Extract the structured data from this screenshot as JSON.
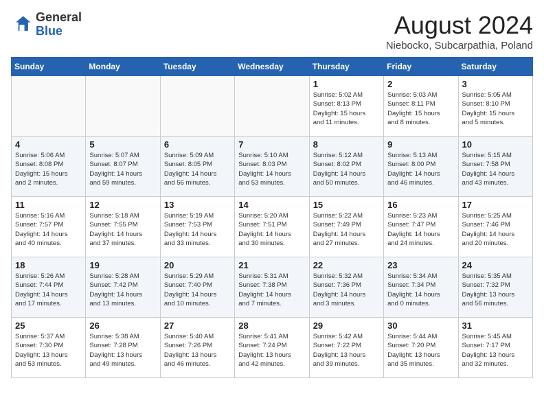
{
  "header": {
    "logo_general": "General",
    "logo_blue": "Blue",
    "month_year": "August 2024",
    "location": "Niebocko, Subcarpathia, Poland"
  },
  "days_of_week": [
    "Sunday",
    "Monday",
    "Tuesday",
    "Wednesday",
    "Thursday",
    "Friday",
    "Saturday"
  ],
  "weeks": [
    [
      {
        "day": "",
        "info": ""
      },
      {
        "day": "",
        "info": ""
      },
      {
        "day": "",
        "info": ""
      },
      {
        "day": "",
        "info": ""
      },
      {
        "day": "1",
        "info": "Sunrise: 5:02 AM\nSunset: 8:13 PM\nDaylight: 15 hours\nand 11 minutes."
      },
      {
        "day": "2",
        "info": "Sunrise: 5:03 AM\nSunset: 8:11 PM\nDaylight: 15 hours\nand 8 minutes."
      },
      {
        "day": "3",
        "info": "Sunrise: 5:05 AM\nSunset: 8:10 PM\nDaylight: 15 hours\nand 5 minutes."
      }
    ],
    [
      {
        "day": "4",
        "info": "Sunrise: 5:06 AM\nSunset: 8:08 PM\nDaylight: 15 hours\nand 2 minutes."
      },
      {
        "day": "5",
        "info": "Sunrise: 5:07 AM\nSunset: 8:07 PM\nDaylight: 14 hours\nand 59 minutes."
      },
      {
        "day": "6",
        "info": "Sunrise: 5:09 AM\nSunset: 8:05 PM\nDaylight: 14 hours\nand 56 minutes."
      },
      {
        "day": "7",
        "info": "Sunrise: 5:10 AM\nSunset: 8:03 PM\nDaylight: 14 hours\nand 53 minutes."
      },
      {
        "day": "8",
        "info": "Sunrise: 5:12 AM\nSunset: 8:02 PM\nDaylight: 14 hours\nand 50 minutes."
      },
      {
        "day": "9",
        "info": "Sunrise: 5:13 AM\nSunset: 8:00 PM\nDaylight: 14 hours\nand 46 minutes."
      },
      {
        "day": "10",
        "info": "Sunrise: 5:15 AM\nSunset: 7:58 PM\nDaylight: 14 hours\nand 43 minutes."
      }
    ],
    [
      {
        "day": "11",
        "info": "Sunrise: 5:16 AM\nSunset: 7:57 PM\nDaylight: 14 hours\nand 40 minutes."
      },
      {
        "day": "12",
        "info": "Sunrise: 5:18 AM\nSunset: 7:55 PM\nDaylight: 14 hours\nand 37 minutes."
      },
      {
        "day": "13",
        "info": "Sunrise: 5:19 AM\nSunset: 7:53 PM\nDaylight: 14 hours\nand 33 minutes."
      },
      {
        "day": "14",
        "info": "Sunrise: 5:20 AM\nSunset: 7:51 PM\nDaylight: 14 hours\nand 30 minutes."
      },
      {
        "day": "15",
        "info": "Sunrise: 5:22 AM\nSunset: 7:49 PM\nDaylight: 14 hours\nand 27 minutes."
      },
      {
        "day": "16",
        "info": "Sunrise: 5:23 AM\nSunset: 7:47 PM\nDaylight: 14 hours\nand 24 minutes."
      },
      {
        "day": "17",
        "info": "Sunrise: 5:25 AM\nSunset: 7:46 PM\nDaylight: 14 hours\nand 20 minutes."
      }
    ],
    [
      {
        "day": "18",
        "info": "Sunrise: 5:26 AM\nSunset: 7:44 PM\nDaylight: 14 hours\nand 17 minutes."
      },
      {
        "day": "19",
        "info": "Sunrise: 5:28 AM\nSunset: 7:42 PM\nDaylight: 14 hours\nand 13 minutes."
      },
      {
        "day": "20",
        "info": "Sunrise: 5:29 AM\nSunset: 7:40 PM\nDaylight: 14 hours\nand 10 minutes."
      },
      {
        "day": "21",
        "info": "Sunrise: 5:31 AM\nSunset: 7:38 PM\nDaylight: 14 hours\nand 7 minutes."
      },
      {
        "day": "22",
        "info": "Sunrise: 5:32 AM\nSunset: 7:36 PM\nDaylight: 14 hours\nand 3 minutes."
      },
      {
        "day": "23",
        "info": "Sunrise: 5:34 AM\nSunset: 7:34 PM\nDaylight: 14 hours\nand 0 minutes."
      },
      {
        "day": "24",
        "info": "Sunrise: 5:35 AM\nSunset: 7:32 PM\nDaylight: 13 hours\nand 56 minutes."
      }
    ],
    [
      {
        "day": "25",
        "info": "Sunrise: 5:37 AM\nSunset: 7:30 PM\nDaylight: 13 hours\nand 53 minutes."
      },
      {
        "day": "26",
        "info": "Sunrise: 5:38 AM\nSunset: 7:28 PM\nDaylight: 13 hours\nand 49 minutes."
      },
      {
        "day": "27",
        "info": "Sunrise: 5:40 AM\nSunset: 7:26 PM\nDaylight: 13 hours\nand 46 minutes."
      },
      {
        "day": "28",
        "info": "Sunrise: 5:41 AM\nSunset: 7:24 PM\nDaylight: 13 hours\nand 42 minutes."
      },
      {
        "day": "29",
        "info": "Sunrise: 5:42 AM\nSunset: 7:22 PM\nDaylight: 13 hours\nand 39 minutes."
      },
      {
        "day": "30",
        "info": "Sunrise: 5:44 AM\nSunset: 7:20 PM\nDaylight: 13 hours\nand 35 minutes."
      },
      {
        "day": "31",
        "info": "Sunrise: 5:45 AM\nSunset: 7:17 PM\nDaylight: 13 hours\nand 32 minutes."
      }
    ]
  ]
}
